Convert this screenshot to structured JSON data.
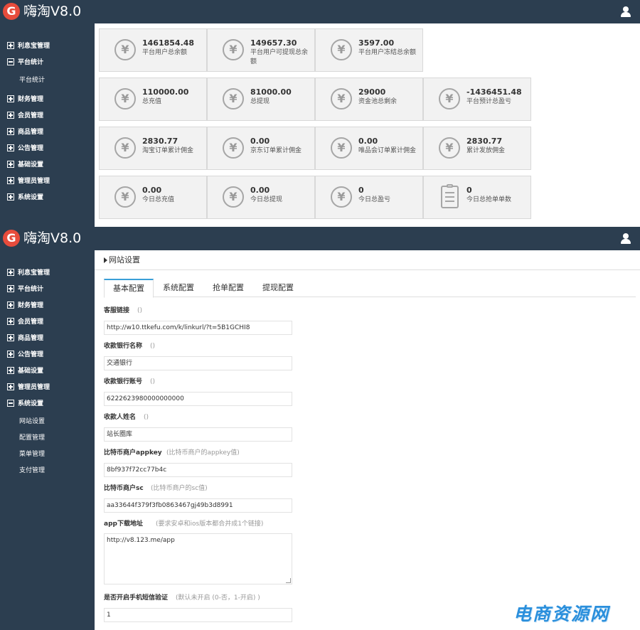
{
  "app": {
    "logo_letter": "G",
    "title": "嗨淘V8.0"
  },
  "sidebar": {
    "items": [
      {
        "label": "利息宝管理"
      },
      {
        "label": "平台统计"
      },
      {
        "label": "财务管理"
      },
      {
        "label": "会员管理"
      },
      {
        "label": "商品管理"
      },
      {
        "label": "公告管理"
      },
      {
        "label": "基础设置"
      },
      {
        "label": "管理员管理"
      },
      {
        "label": "系统设置"
      }
    ],
    "top_subitems": [
      {
        "label": "平台统计"
      }
    ],
    "bottom_subitems": [
      {
        "label": "网站设置"
      },
      {
        "label": "配置管理"
      },
      {
        "label": "菜单管理"
      },
      {
        "label": "支付管理"
      }
    ]
  },
  "stats": [
    {
      "value": "1461854.48",
      "label": "平台用户总余额",
      "icon": "yen-coin-icon"
    },
    {
      "value": "149657.30",
      "label": "平台用户可提现总余额",
      "icon": "yen-coin-icon"
    },
    {
      "value": "3597.00",
      "label": "平台用户冻结总余额",
      "icon": "yen-coin-icon"
    },
    {
      "value": "110000.00",
      "label": "总充值",
      "icon": "yen-coin-icon"
    },
    {
      "value": "81000.00",
      "label": "总提现",
      "icon": "yen-coin-icon"
    },
    {
      "value": "29000",
      "label": "资金池总剩余",
      "icon": "yen-coin-icon"
    },
    {
      "value": "-1436451.48",
      "label": "平台预计总盈亏",
      "icon": "yen-coin-icon"
    },
    {
      "value": "2830.77",
      "label": "淘宝订单累计佣金",
      "icon": "yen-coin-icon"
    },
    {
      "value": "0.00",
      "label": "京东订单累计佣金",
      "icon": "yen-coin-icon"
    },
    {
      "value": "0.00",
      "label": "唯品会订单累计佣金",
      "icon": "yen-coin-icon"
    },
    {
      "value": "2830.77",
      "label": "累计发放佣金",
      "icon": "yen-coin-icon"
    },
    {
      "value": "0.00",
      "label": "今日总充值",
      "icon": "yen-coin-icon"
    },
    {
      "value": "0.00",
      "label": "今日总提现",
      "icon": "yen-coin-icon"
    },
    {
      "value": "0",
      "label": "今日总盈亏",
      "icon": "yen-coin-icon"
    },
    {
      "value": "0",
      "label": "今日总抢单单数",
      "icon": "clipboard-icon"
    }
  ],
  "icons": {
    "coin_glyph": "¥"
  },
  "settings": {
    "page_title": "网站设置",
    "tabs": [
      {
        "label": "基本配置"
      },
      {
        "label": "系统配置"
      },
      {
        "label": "抢单配置"
      },
      {
        "label": "提现配置"
      }
    ],
    "fields": [
      {
        "label": "客服链接",
        "hint": "()",
        "value": "http://w10.ttkefu.com/k/linkurl/?t=5B1GCHI8"
      },
      {
        "label": "收款银行名称",
        "hint": "()",
        "value": "交通银行"
      },
      {
        "label": "收款银行账号",
        "hint": "()",
        "value": "6222623980000000000"
      },
      {
        "label": "收款人姓名",
        "hint": "()",
        "value": "站长圈库"
      },
      {
        "label": "比特币商户appkey",
        "hint": "(比特币商户的appkey值)",
        "value": "8bf937f72cc77b4c"
      },
      {
        "label": "比特币商户sc",
        "hint": "(比特币商户的sc值)",
        "value": "aa33644f379f3fb0863467gj49b3d8991"
      },
      {
        "label": "app下载地址",
        "hint": "(要求安卓和ios版本都合并成1个链接)",
        "value": "http://v8.123.me/app"
      },
      {
        "label": "是否开启手机短信验证",
        "hint": "(默认未开启 (0-否，1-开启) )",
        "value": "1"
      }
    ]
  },
  "watermark": {
    "text": "电商资源网"
  },
  "colors": {
    "sidebar": "#2c3e50",
    "accent": "#3a9fd8",
    "card_bg": "#f2f2f2"
  }
}
